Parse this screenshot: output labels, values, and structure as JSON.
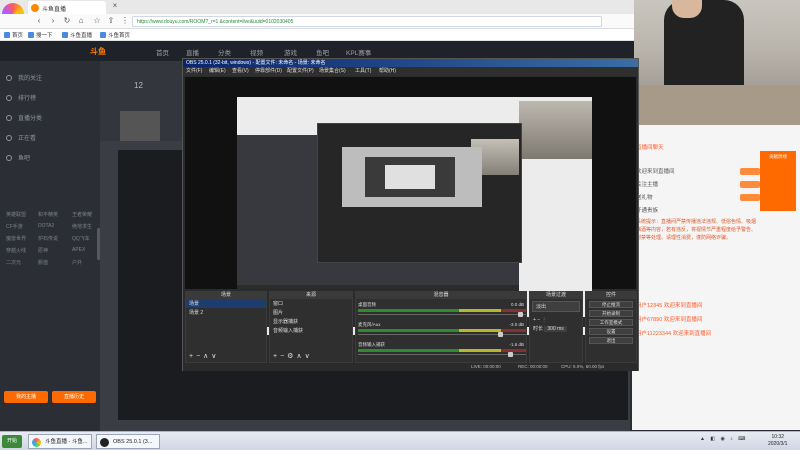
{
  "browser": {
    "tabs": [
      "斗鱼直播",
      "斗鱼直播",
      "斗鱼首页"
    ],
    "url": "https://www.douyu.com/ROOM?_r=1 &content=live&uuid=0102030405",
    "bookmarks": [
      "首页",
      "搜一下",
      "斗鱼直播",
      "斗鱼首页"
    ]
  },
  "site": {
    "brand": "斗鱼",
    "nav": [
      "首页",
      "直播",
      "分类",
      "视频",
      "游戏",
      "鱼吧",
      "KPL赛事"
    ],
    "leftnav": [
      "我的关注",
      "排行榜",
      "直播分类",
      "正在看",
      "鱼吧"
    ],
    "leftsubs": [
      "英雄联盟",
      "和平精英",
      "王者荣耀",
      "CF手游",
      "DOTA2",
      "绝地求生",
      "魔兽世界",
      "炉石传说",
      "QQ飞车",
      "穿越火线",
      "原神",
      "APEX",
      "二次元",
      "颜值",
      "户外"
    ],
    "room_count": "12",
    "left_buttons": [
      "我的主播",
      "直播历史"
    ]
  },
  "obs": {
    "title": "OBS 25.0.1 (32-bit, windows) - 配置文件: 未命名 - 场景: 未命名",
    "menu": [
      "文件(F)",
      "编辑(E)",
      "查看(V)",
      "停靠部件(D)",
      "配置文件(P)",
      "场景集合(S)",
      "工具(T)",
      "帮助(H)"
    ],
    "docks": {
      "scenes": {
        "title": "场景",
        "items": [
          "场景",
          "场景 2"
        ]
      },
      "sources": {
        "title": "来源",
        "items": [
          "窗口",
          "图片",
          "显示器捕获",
          "音频输入捕获"
        ]
      },
      "mixer": {
        "title": "混音器",
        "tracks": [
          {
            "name": "桌面音频",
            "db": "0.0 dB"
          },
          {
            "name": "麦克风/Aux",
            "db": "-3.0 dB"
          },
          {
            "name": "音频输入捕获",
            "db": "-1.6 dB"
          }
        ]
      },
      "transitions": {
        "title": "场景过渡",
        "type": "淡出",
        "duration_label": "时长",
        "duration": "300 ms"
      },
      "controls": {
        "title": "控件",
        "buttons": [
          "停止推流",
          "开始录制",
          "工作室模式",
          "设置",
          "退出"
        ]
      }
    },
    "status": {
      "live": "LIVE: 00:00:00",
      "rec": "REC: 00:00:00",
      "cpu": "CPU: 5.0%, 60.00 fps"
    }
  },
  "chat": {
    "header": "直播间聊天",
    "lines": [
      "欢迎来到直播间",
      "关注主播",
      "送礼物",
      "开通贵族",
      "主播等级",
      "粉丝团"
    ],
    "notice": "系统提示：直播间严禁传播违法违规、低俗色情、吸烟酗酒等内容，若有违反，将视情节严重程度给予警告、封禁等处理。请理性消费，谨防网络诈骗。",
    "entries": [
      "用户12345 欢迎来到直播间",
      "用户67890 欢迎来到直播间",
      "用户11223344 欢迎来到直播间"
    ],
    "rank_label": "贡献周榜"
  },
  "taskbar": {
    "start": "开始",
    "tasks": [
      "斗鱼直播 - 斗鱼...",
      "OBS 25.0.1 (3..."
    ],
    "time": "10:32",
    "date": "2020/3/1"
  }
}
